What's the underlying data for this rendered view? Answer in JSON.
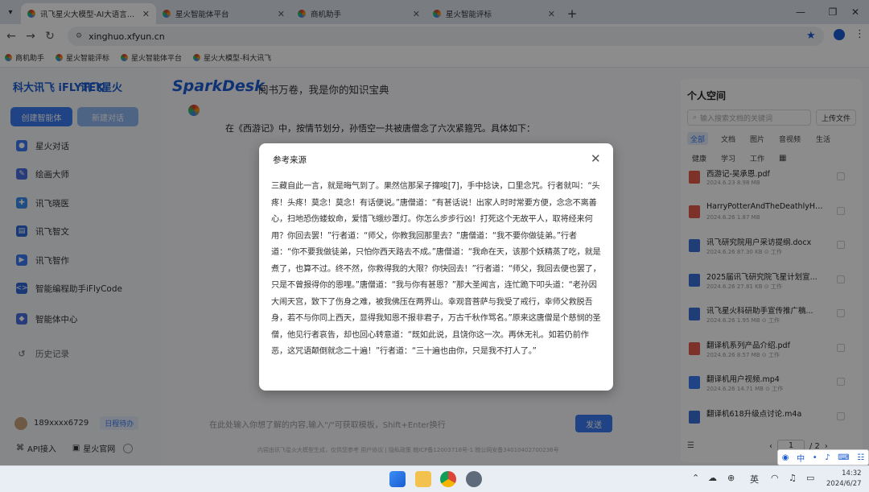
{
  "browser": {
    "tabs": [
      {
        "title": "讯飞星火大模型-AI大语言模型-星"
      },
      {
        "title": "星火智能体平台"
      },
      {
        "title": "商机助手"
      },
      {
        "title": "星火智能评标"
      }
    ],
    "url": "xinghuo.xfyun.cn",
    "bookmarks": [
      "商机助手",
      "星火智能评标",
      "星火智能体平台",
      "星火大模型-科大讯飞"
    ]
  },
  "sidebar": {
    "logo_iflytek": "科大讯飞 iFLYTEK",
    "logo_spark": "讯飞星火",
    "create_btn": "创建智能体",
    "new_chat_btn": "新建对话",
    "items": [
      {
        "label": "星火对话",
        "icon": "chat-icon"
      },
      {
        "label": "绘画大师",
        "icon": "paint-icon"
      },
      {
        "label": "讯飞晓医",
        "icon": "medical-icon"
      },
      {
        "label": "讯飞智文",
        "icon": "document-icon"
      },
      {
        "label": "讯飞智作",
        "icon": "video-icon"
      },
      {
        "label": "智能编程助手iFlyCode",
        "icon": "code-icon"
      },
      {
        "label": "智能体中心",
        "icon": "agent-icon"
      },
      {
        "label": "历史记录",
        "icon": "history-icon"
      }
    ],
    "user": {
      "name": "189xxxx6729",
      "badge": "日程待办"
    },
    "api_link": "API接入",
    "site_link": "星火官网"
  },
  "main": {
    "brand": "SparkDesk",
    "slogan": "阅书万卷，我是你的知识宝典",
    "answer_intro": "在《西游记》中，按情节划分，孙悟空一共被唐僧念了六次紧箍咒。具体如下：",
    "input_placeholder": "在此处输入你想了解的内容,输入\"/\"可获取模板，Shift+Enter换行",
    "send_btn": "发送",
    "footer": "内容由讯飞星火大模型生成，仅供您参考   用户协议 | 隐私政策   皖ICP备12003718号-1   皖公网安备34010402700236号"
  },
  "modal": {
    "title": "参考来源",
    "body": "三藏自此一言，就是晦气到了。果然信那呆子撺唆[7]，手中捻诀，口里念咒。行者就叫：“头疼！头疼！莫念！莫念！有话便说。”唐僧道：“有甚话说！出家人时时常要方便，念念不离善心，扫地恐伤蝼蚁命，爱惜飞蛾纱罩灯。你怎么步步行凶！打死这个无故平人，取将经来何用？你回去罢！”行者道：“师父，你教我回那里去？”唐僧道：“我不要你做徒弟。”行者道：“你不要我做徒弟，只怕你西天路去不成。”唐僧道：“我命在天，该那个妖精蒸了吃，就是煮了，也算不过。终不然，你救得我的大限？你快回去！”行者道：“师父，我回去便也罢了，只是不曾报得你的恩哩。”唐僧道：“我与你有甚恩？”那大圣闻言，连忙跪下叩头道：“老孙因大闹天宫，致下了伤身之难，被我佛压在两界山。幸观音菩萨与我受了戒行，幸师父救脱吾身，若不与你同上西天，显得我知恩不报非君子，万古千秋作骂名。”原来这唐僧是个慈悯的圣僧，他见行者哀告，却也回心转意道：“既如此说，且饶你这一次。再休无礼。如若仍前作恶，这咒语颠倒就念二十遍！”行者道：“三十遍也由你，只是我不打人了。”"
  },
  "right_panel": {
    "title": "个人空间",
    "search_placeholder": "输入搜索文档的关键词",
    "upload_btn": "上传文件",
    "filters": [
      "全部",
      "文档",
      "图片",
      "音视频",
      "生活",
      "健康",
      "学习",
      "工作"
    ],
    "files": [
      {
        "name": "西游记-吴承恩.pdf",
        "meta": "2024.6.23  8.98 MB",
        "type": "pdf"
      },
      {
        "name": "HarryPotterAndTheDeathlyHall...",
        "meta": "2024.6.26  1.87 MB",
        "type": "pdf"
      },
      {
        "name": "讯飞研究院用户采访提纲.docx",
        "meta": "2024.6.26  87.30 KB  ⊙ 工作",
        "type": "doc"
      },
      {
        "name": "2025届讯飞研究院飞星计划宣...",
        "meta": "2024.6.26  27.81 KB  ⊙ 工作",
        "type": "doc"
      },
      {
        "name": "讯飞星火科研助手宣传推广稿...",
        "meta": "2024.6.26  1.95 MB  ⊙ 工作",
        "type": "doc"
      },
      {
        "name": "翻译机系列产品介绍.pdf",
        "meta": "2024.6.26  8.57 MB  ⊙ 工作",
        "type": "pdf"
      },
      {
        "name": "翻译机用户视频.mp4",
        "meta": "2024.6.26  14.71 MB  ⊙ 工作",
        "type": "video"
      },
      {
        "name": "翻译机618升级点讨论.m4a",
        "meta": "",
        "type": "audio"
      }
    ],
    "page_current": "1",
    "page_total": "/ 2"
  },
  "taskbar": {
    "time": "14:32",
    "date": "2024/6/27",
    "ime": "中"
  }
}
